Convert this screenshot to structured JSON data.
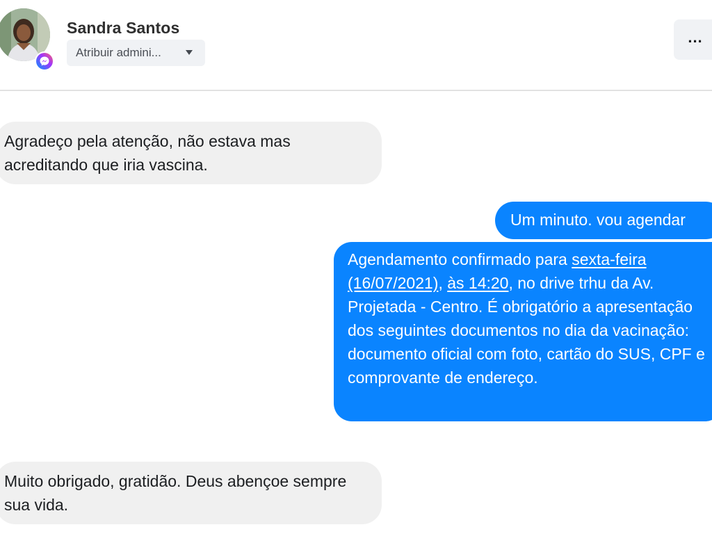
{
  "header": {
    "contact_name": "Sandra Santos",
    "assign_label": "Atribuir admini...",
    "more_label": "...",
    "badge_icon": "messenger-icon",
    "brand_colors": {
      "outgoing_bubble": "#0a84ff",
      "incoming_bubble": "#f0f0f0"
    }
  },
  "messages": [
    {
      "direction": "incoming",
      "text": "Agradeço pela atenção, não estava mas acreditando que iria vascina."
    },
    {
      "direction": "outgoing",
      "text": "Um minuto. vou agendar"
    },
    {
      "direction": "outgoing",
      "parts": {
        "p1": "Agendamento confirmado para ",
        "link_day": "sexta-feira",
        "p2": " ",
        "link_date": "(16/07/2021)",
        "p3": ", ",
        "link_time": "às 14:20",
        "p4": ", no drive trhu da Av. Projetada - Centro. É obrigatório a apresentação dos seguintes documentos no dia da vacinação: documento oficial com foto, cartão do SUS, CPF e comprovante de endereço."
      }
    },
    {
      "direction": "incoming",
      "text": "Muito obrigado, gratidão. Deus abençoe sempre sua vida."
    }
  ]
}
